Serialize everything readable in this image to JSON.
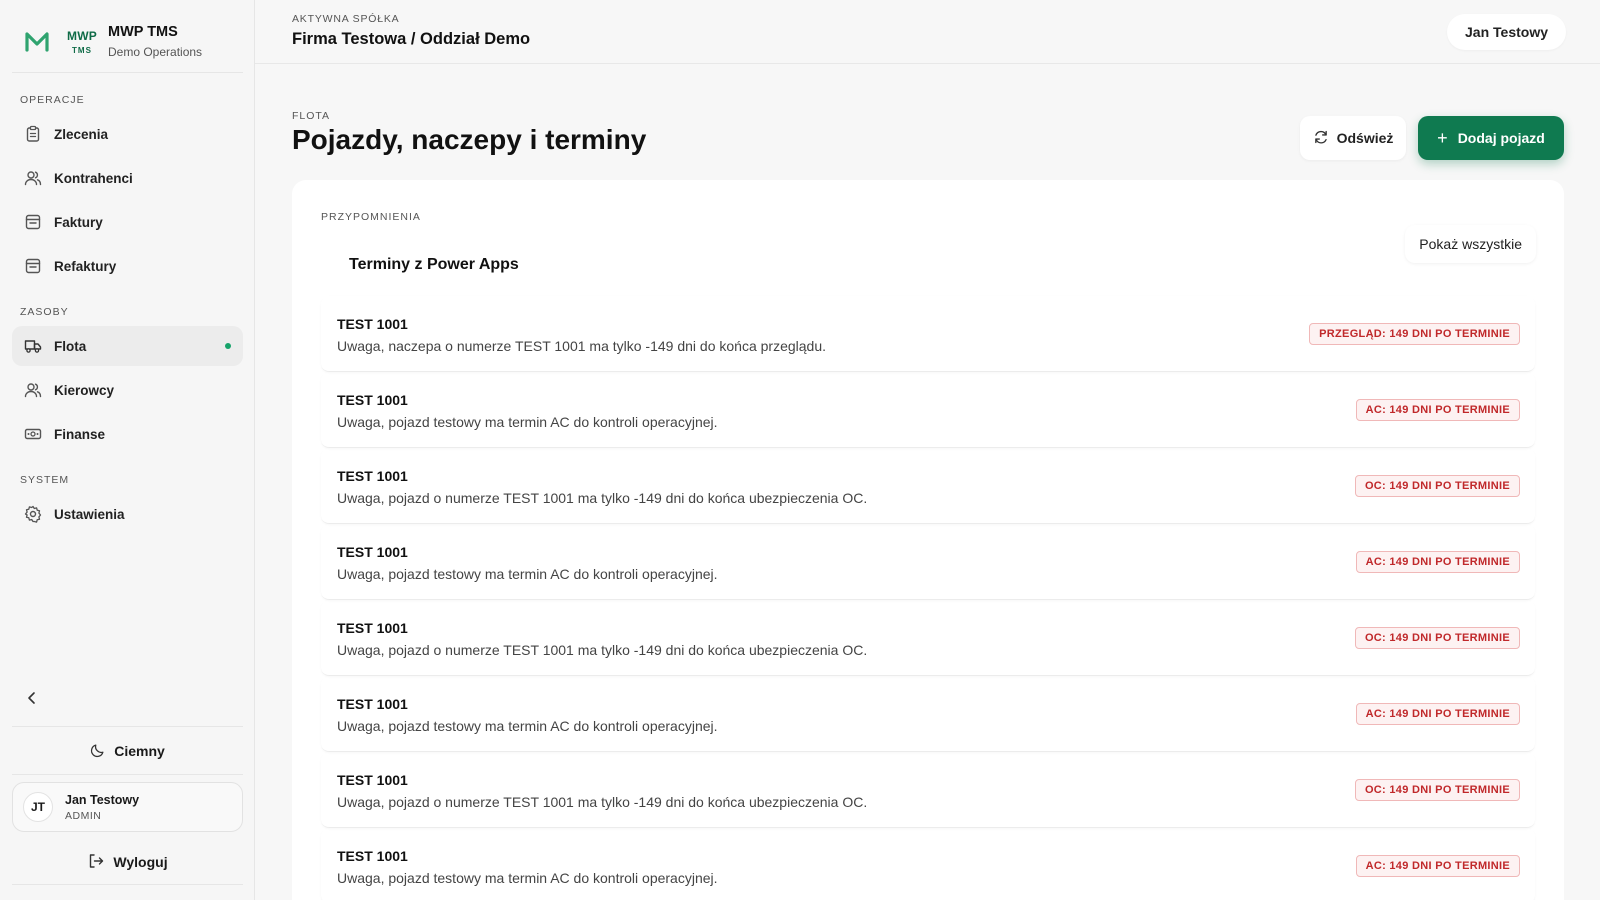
{
  "brand": {
    "mark_top": "MWP",
    "mark_bottom": "TMS",
    "name": "MWP TMS",
    "subtitle": "Demo Operations",
    "accent": "#0f7a50"
  },
  "sidebar": {
    "sections": [
      {
        "label": "OPERACJE",
        "items": [
          {
            "label": "Zlecenia",
            "icon": "clipboard-icon"
          },
          {
            "label": "Kontrahenci",
            "icon": "users-icon"
          },
          {
            "label": "Faktury",
            "icon": "invoice-icon"
          },
          {
            "label": "Refaktury",
            "icon": "invoice-icon"
          }
        ]
      },
      {
        "label": "ZASOBY",
        "items": [
          {
            "label": "Flota",
            "icon": "truck-icon",
            "active": true
          },
          {
            "label": "Kierowcy",
            "icon": "users-icon"
          },
          {
            "label": "Finanse",
            "icon": "money-icon"
          }
        ]
      },
      {
        "label": "SYSTEM",
        "items": [
          {
            "label": "Ustawienia",
            "icon": "gear-icon"
          }
        ]
      }
    ],
    "theme_label": "Ciemny",
    "user": {
      "initials": "JT",
      "name": "Jan Testowy",
      "role": "ADMIN"
    },
    "logout_label": "Wyloguj"
  },
  "header": {
    "company_label": "AKTYWNA SPÓŁKA",
    "company_name": "Firma Testowa / Oddział Demo",
    "user_name": "Jan Testowy"
  },
  "page": {
    "kicker": "FLOTA",
    "title": "Pojazdy, naczepy i terminy",
    "refresh_label": "Odśwież",
    "add_label": "Dodaj pojazd"
  },
  "reminders": {
    "kicker": "PRZYPOMNIENIA",
    "title": "Terminy z Power Apps",
    "show_all_label": "Pokaż wszystkie",
    "items": [
      {
        "title": "TEST 1001",
        "desc": "Uwaga, naczepa o numerze TEST 1001 ma tylko -149 dni do końca przeglądu.",
        "badge": "PRZEGLĄD: 149 DNI PO TERMINIE"
      },
      {
        "title": "TEST 1001",
        "desc": "Uwaga, pojazd testowy ma termin AC do kontroli operacyjnej.",
        "badge": "AC: 149 DNI PO TERMINIE"
      },
      {
        "title": "TEST 1001",
        "desc": "Uwaga, pojazd o numerze TEST 1001 ma tylko -149 dni do końca ubezpieczenia OC.",
        "badge": "OC: 149 DNI PO TERMINIE"
      },
      {
        "title": "TEST 1001",
        "desc": "Uwaga, pojazd testowy ma termin AC do kontroli operacyjnej.",
        "badge": "AC: 149 DNI PO TERMINIE"
      },
      {
        "title": "TEST 1001",
        "desc": "Uwaga, pojazd o numerze TEST 1001 ma tylko -149 dni do końca ubezpieczenia OC.",
        "badge": "OC: 149 DNI PO TERMINIE"
      },
      {
        "title": "TEST 1001",
        "desc": "Uwaga, pojazd testowy ma termin AC do kontroli operacyjnej.",
        "badge": "AC: 149 DNI PO TERMINIE"
      },
      {
        "title": "TEST 1001",
        "desc": "Uwaga, pojazd o numerze TEST 1001 ma tylko -149 dni do końca ubezpieczenia OC.",
        "badge": "OC: 149 DNI PO TERMINIE"
      },
      {
        "title": "TEST 1001",
        "desc": "Uwaga, pojazd testowy ma termin AC do kontroli operacyjnej.",
        "badge": "AC: 149 DNI PO TERMINIE"
      }
    ]
  }
}
